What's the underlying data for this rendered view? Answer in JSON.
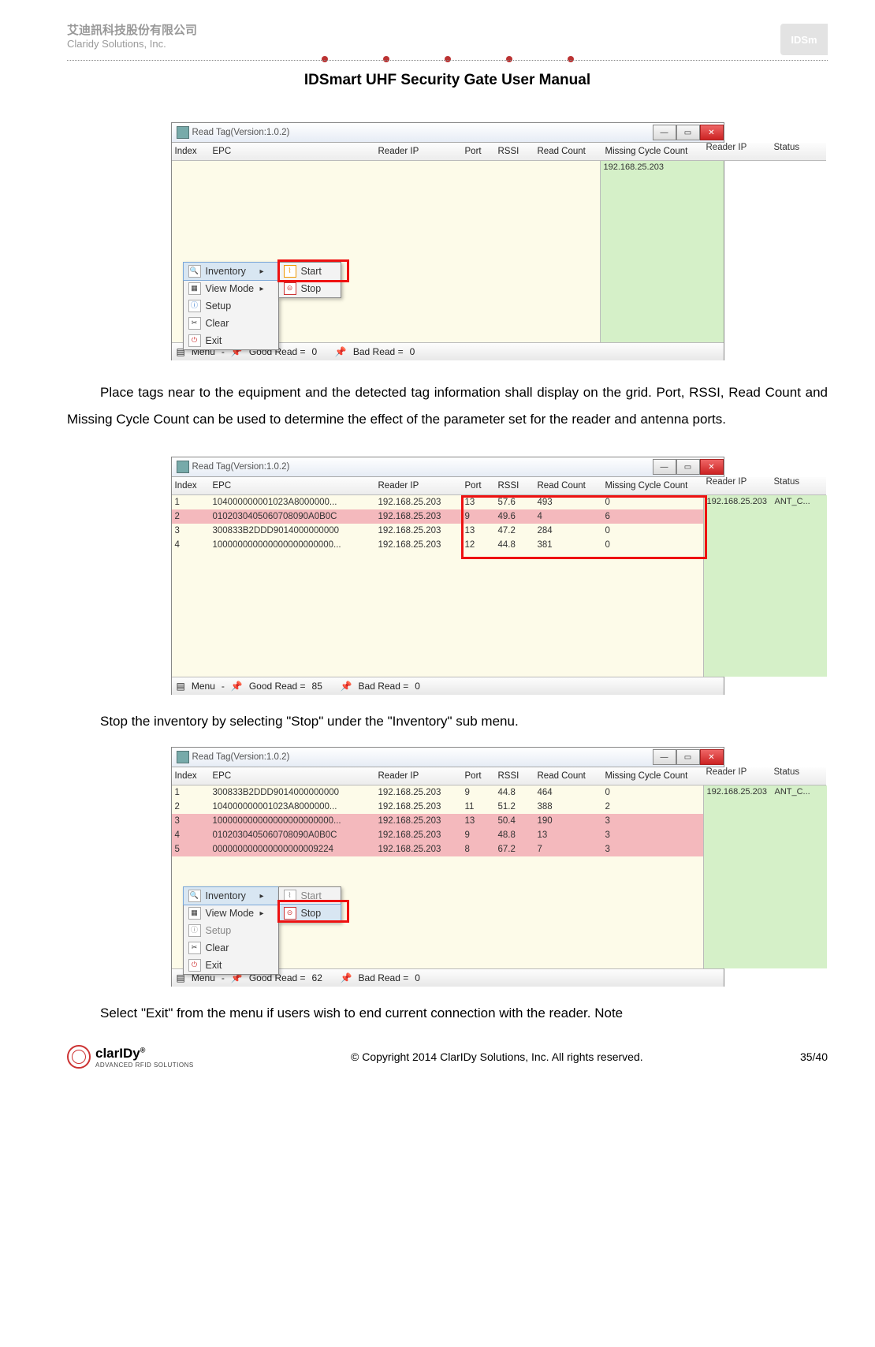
{
  "header": {
    "company_ch": "艾迪訊科技股份有限公司",
    "company_en": "Claridy Solutions, Inc.",
    "logo_right": "IDSm",
    "manual_title": "IDSmart UHF Security Gate User Manual"
  },
  "screenshots": {
    "window_title": "Read Tag(Version:1.0.2)",
    "columns_left": [
      "Index",
      "EPC",
      "Reader IP",
      "Port",
      "RSSI",
      "Read Count",
      "Missing Cycle Count"
    ],
    "columns_right": [
      "Reader IP",
      "Status"
    ],
    "right_row": {
      "ip": "192.168.25.203",
      "status": "ANT_C..."
    },
    "menu": {
      "button": "Menu",
      "items": [
        "Inventory",
        "View Mode",
        "Setup",
        "Clear",
        "Exit"
      ],
      "sub_inventory": [
        "Start",
        "Stop"
      ]
    },
    "status": {
      "label_good": "Good Read =",
      "label_bad": "Bad Read ="
    },
    "s1": {
      "good": "0",
      "bad": "0"
    },
    "s2": {
      "good": "85",
      "bad": "0",
      "rows": [
        {
          "idx": "1",
          "epc": "104000000001023A8000000...",
          "ip": "192.168.25.203",
          "port": "13",
          "rssi": "57.6",
          "rc": "493",
          "mc": "0",
          "pink": false
        },
        {
          "idx": "2",
          "epc": "0102030405060708090A0B0C",
          "ip": "192.168.25.203",
          "port": "9",
          "rssi": "49.6",
          "rc": "4",
          "mc": "6",
          "pink": true
        },
        {
          "idx": "3",
          "epc": "300833B2DDD9014000000000",
          "ip": "192.168.25.203",
          "port": "13",
          "rssi": "47.2",
          "rc": "284",
          "mc": "0",
          "pink": false
        },
        {
          "idx": "4",
          "epc": "100000000000000000000000...",
          "ip": "192.168.25.203",
          "port": "12",
          "rssi": "44.8",
          "rc": "381",
          "mc": "0",
          "pink": false
        }
      ]
    },
    "s3": {
      "good": "62",
      "bad": "0",
      "rows": [
        {
          "idx": "1",
          "epc": "300833B2DDD9014000000000",
          "ip": "192.168.25.203",
          "port": "9",
          "rssi": "44.8",
          "rc": "464",
          "mc": "0",
          "pink": false
        },
        {
          "idx": "2",
          "epc": "104000000001023A8000000...",
          "ip": "192.168.25.203",
          "port": "11",
          "rssi": "51.2",
          "rc": "388",
          "mc": "2",
          "pink": false
        },
        {
          "idx": "3",
          "epc": "100000000000000000000000...",
          "ip": "192.168.25.203",
          "port": "13",
          "rssi": "50.4",
          "rc": "190",
          "mc": "3",
          "pink": true
        },
        {
          "idx": "4",
          "epc": "0102030405060708090A0B0C",
          "ip": "192.168.25.203",
          "port": "9",
          "rssi": "48.8",
          "rc": "13",
          "mc": "3",
          "pink": true
        },
        {
          "idx": "5",
          "epc": "000000000000000000009224",
          "ip": "192.168.25.203",
          "port": "8",
          "rssi": "67.2",
          "rc": "7",
          "mc": "3",
          "pink": true
        }
      ]
    }
  },
  "paragraphs": {
    "p1": "Place tags near to the equipment and the detected tag information shall display on the grid. Port, RSSI, Read Count and Missing Cycle Count can be used to determine the effect of the parameter set for the reader and antenna ports.",
    "p2": "Stop the inventory by selecting \"Stop\" under the \"Inventory\" sub menu.",
    "p3": "Select \"Exit\" from the menu if users wish to end current connection with the reader. Note"
  },
  "footer": {
    "logo_brand": "clarIDy",
    "logo_tag": "ADVANCED RFID SOLUTIONS",
    "copyright": "© Copyright 2014 ClarIDy Solutions, Inc. All rights reserved.",
    "page": "35/40"
  }
}
